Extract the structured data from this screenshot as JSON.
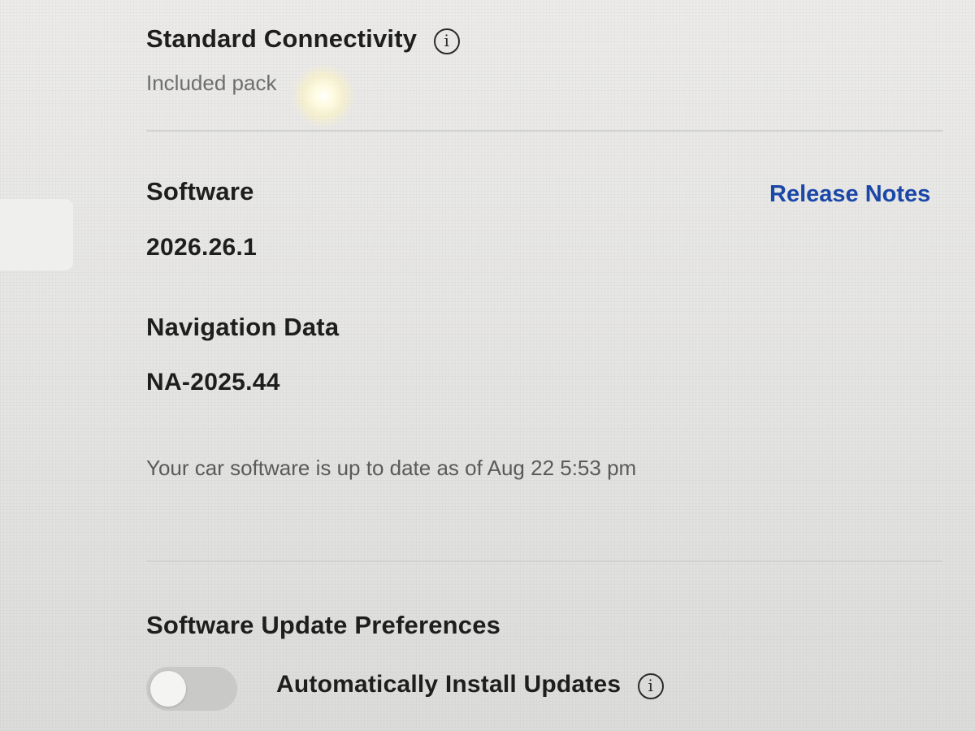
{
  "connectivity": {
    "title": "Standard Connectivity",
    "subtitle": "Included pack"
  },
  "software": {
    "title": "Software",
    "version": "2026.26.1",
    "release_notes_label": "Release Notes"
  },
  "navigation": {
    "title": "Navigation Data",
    "version": "NA-2025.44"
  },
  "status": {
    "message": "Your car software is up to date as of Aug 22 5:53 pm"
  },
  "update_preferences": {
    "title": "Software Update Preferences",
    "auto_install_label": "Automatically Install Updates",
    "auto_install_enabled": false
  },
  "icons": {
    "info": "info-icon",
    "info_glyph": "i"
  },
  "colors": {
    "link": "#1a47a8",
    "background": "#e6e6e4"
  }
}
